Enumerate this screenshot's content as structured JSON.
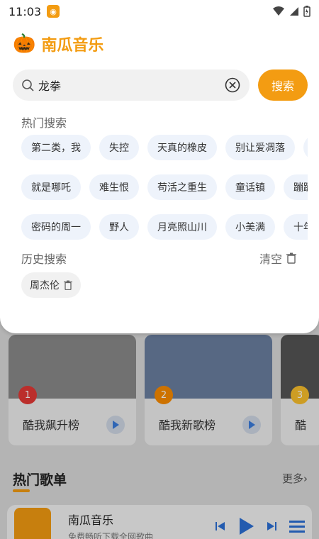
{
  "status": {
    "time": "11:03"
  },
  "app": {
    "name": "南瓜音乐"
  },
  "search": {
    "value": "龙拳",
    "button_label": "搜索"
  },
  "hot_search": {
    "title": "热门搜索",
    "rows": [
      [
        "第二类，我",
        "失控",
        "天真的橡皮",
        "别让爱凋落",
        "..."
      ],
      [
        "就是哪吒",
        "难生恨",
        "苟活之重生",
        "童话镇",
        "蹦蹦"
      ],
      [
        "密码的周一",
        "野人",
        "月亮照山川",
        "小美满",
        "十年"
      ]
    ]
  },
  "history": {
    "title": "历史搜索",
    "clear_label": "清空",
    "items": [
      "周杰伦"
    ]
  },
  "charts": [
    {
      "rank": "1",
      "title": "酷我飙升榜",
      "badge_color": "#e53935"
    },
    {
      "rank": "2",
      "title": "酷我新歌榜",
      "badge_color": "#fb8c00"
    },
    {
      "rank": "3",
      "title": "酷",
      "badge_color": "#fbc02d"
    }
  ],
  "hot_playlists": {
    "title": "热门歌单",
    "more_label": "更多›"
  },
  "player": {
    "name": "南瓜音乐",
    "subtitle": "免费畅听下载全网歌曲"
  },
  "colors": {
    "accent": "#f39c12",
    "chip_bg": "#eef3fb"
  }
}
